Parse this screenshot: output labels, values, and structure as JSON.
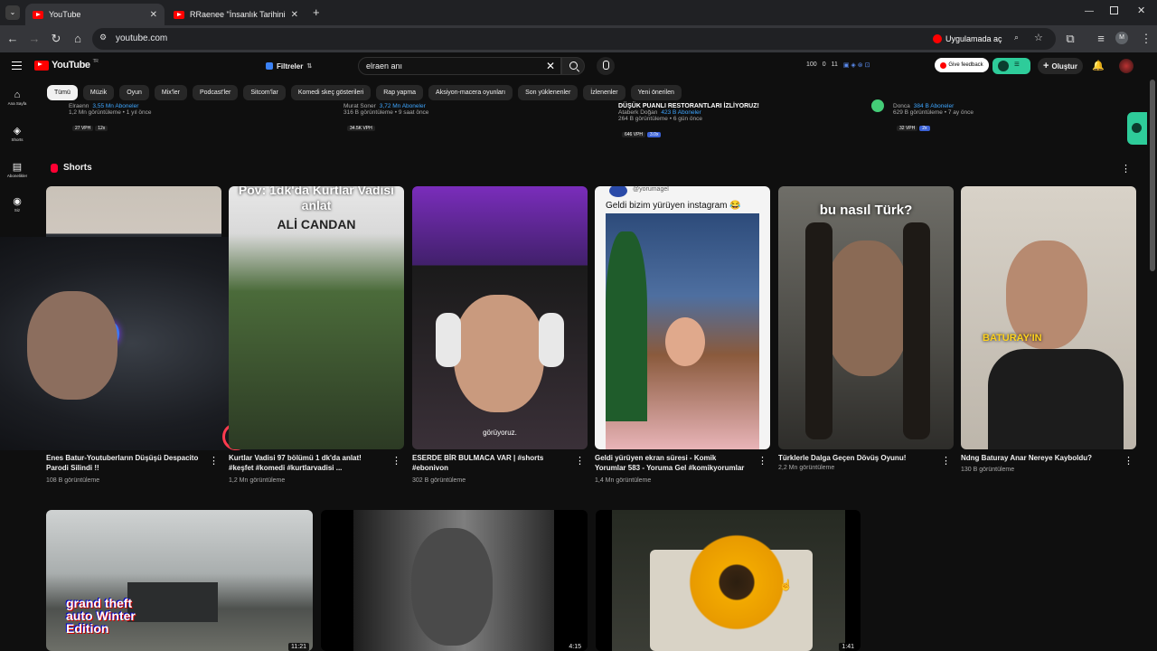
{
  "browser": {
    "tabs": [
      {
        "title": "YouTube",
        "active": true
      },
      {
        "title": "RRaenee \"İnsanlık Tarihinin En",
        "active": false
      }
    ],
    "url": "youtube.com",
    "open_in_app": "Uygulamada aç",
    "profile_initial": "M"
  },
  "header": {
    "logo": "YouTube",
    "country": "TR",
    "filters_label": "Filtreler",
    "search_query": "elraen anı",
    "stats": [
      "100",
      "0",
      "11"
    ],
    "feedback_label": "Give feedback",
    "create_label": "Oluştur"
  },
  "sidebar": {
    "items": [
      {
        "label": "Ana Sayfa",
        "icon": "home-icon"
      },
      {
        "label": "Shorts",
        "icon": "shorts-icon"
      },
      {
        "label": "Abonelikler",
        "icon": "subscriptions-icon"
      },
      {
        "label": "Siz",
        "icon": "you-icon"
      }
    ]
  },
  "chips": [
    "Tümü",
    "Müzik",
    "Oyun",
    "Mix'ler",
    "Podcast'ler",
    "Sitcom'lar",
    "Komedi skeç gösterileri",
    "Rap yapma",
    "Aksiyon-macera oyunları",
    "Son yüklenenler",
    "İzlenenler",
    "Yeni önerilen"
  ],
  "top_row": [
    {
      "channel": "Elraenn",
      "subs": "3,55 Mn Aboneler",
      "meta": "1,2 Mn görüntüleme • 1 yıl önce",
      "vph": "27 VPH",
      "extra": "12x",
      "title": ""
    },
    {
      "channel": "Murat Soner",
      "subs": "3,72 Mn Aboneler",
      "meta": "316 B görüntüleme • 9 saat önce",
      "vph": "34.5K VPH",
      "extra": "",
      "title": ""
    },
    {
      "channel": "Ataberk Doğan",
      "subs": "423 B Aboneler",
      "meta": "264 B görüntüleme • 6 gün önce",
      "vph": "646 VPH",
      "extra": "3.0x",
      "title": "DÜŞÜK PUANLI RESTORANTLARI İZLİYORUZ!"
    },
    {
      "channel": "Donca",
      "subs": "384 B Aboneler",
      "meta": "629 B görüntüleme • 7 ay önce",
      "vph": "32 VPH",
      "extra": "2x",
      "title": ""
    }
  ],
  "shorts": {
    "heading": "Shorts",
    "items": [
      {
        "title": "Enes Batur-Youtuberların Düşüşü Despacito Parodi Silindi !!",
        "views": "108 B görüntüleme"
      },
      {
        "title": "Kurtlar Vadisi 97 bölümü 1 dk'da anlat! #keşfet #komedi #kurtlarvadisi ...",
        "views": "1,2 Mn görüntüleme",
        "overlay": "Pov: 1dk'da Kurtlar Vadisi anlat",
        "overlay2": "ALİ CANDAN"
      },
      {
        "title": "ESERDE BİR BULMACA VAR | #shorts #ebonivon",
        "views": "302 B görüntüleme",
        "caption": "görüyoruz."
      },
      {
        "title": "Geldi yürüyen ekran süresi - Komik Yorumlar 583 - Yoruma Gel #komikyorumlar",
        "views": "1,4 Mn görüntüleme",
        "handle": "@yorumagel",
        "overlay": "Geldi bizim yürüyen instagram 😂"
      },
      {
        "title": "Türklerle Dalga Geçen Dövüş Oyunu!",
        "views": "2,2 Mn görüntüleme",
        "overlay": "bu nasıl Türk?"
      },
      {
        "title": "Ndng Baturay Anar Nereye Kayboldu?",
        "views": "130 B görüntüleme",
        "overlay": "BATURAY'IN"
      }
    ]
  },
  "bottom_videos": [
    {
      "overlay": "grand theft auto Winter Edition",
      "duration": "11:21"
    },
    {
      "overlay": "",
      "duration": "4:15"
    },
    {
      "overlay": "",
      "duration": "1:41"
    }
  ]
}
